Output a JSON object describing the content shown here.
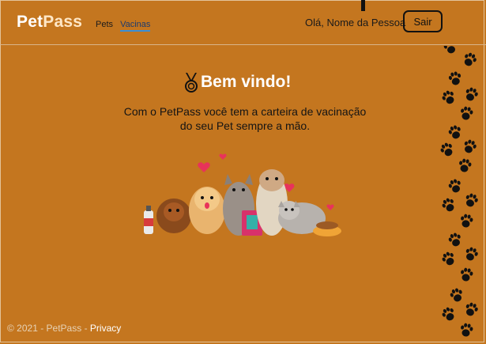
{
  "brand": {
    "part1": "Pet",
    "part2": "Pass"
  },
  "nav": {
    "items": [
      "Pets",
      "Vacinas"
    ],
    "active": "Vacinas"
  },
  "user": {
    "greeting": "Olá, Nome da Pessoa",
    "logout_label": "Sair"
  },
  "main": {
    "welcome_icon": "medal-icon",
    "welcome_title": "Bem vindo!",
    "subtitle_line1": "Com o PetPass você tem a carteira de vacinação",
    "subtitle_line2": "do seu Pet sempre a mão."
  },
  "footer": {
    "copyright": "© 2021 - PetPass",
    "separator": " - ",
    "privacy_label": "Privacy"
  },
  "decor": {
    "side_pattern": "paw-prints-icon",
    "hero_image": "pets-group-illustration"
  },
  "colors": {
    "background": "#c4761f",
    "text_dark": "#141414",
    "accent_link": "#3a8fd6"
  }
}
